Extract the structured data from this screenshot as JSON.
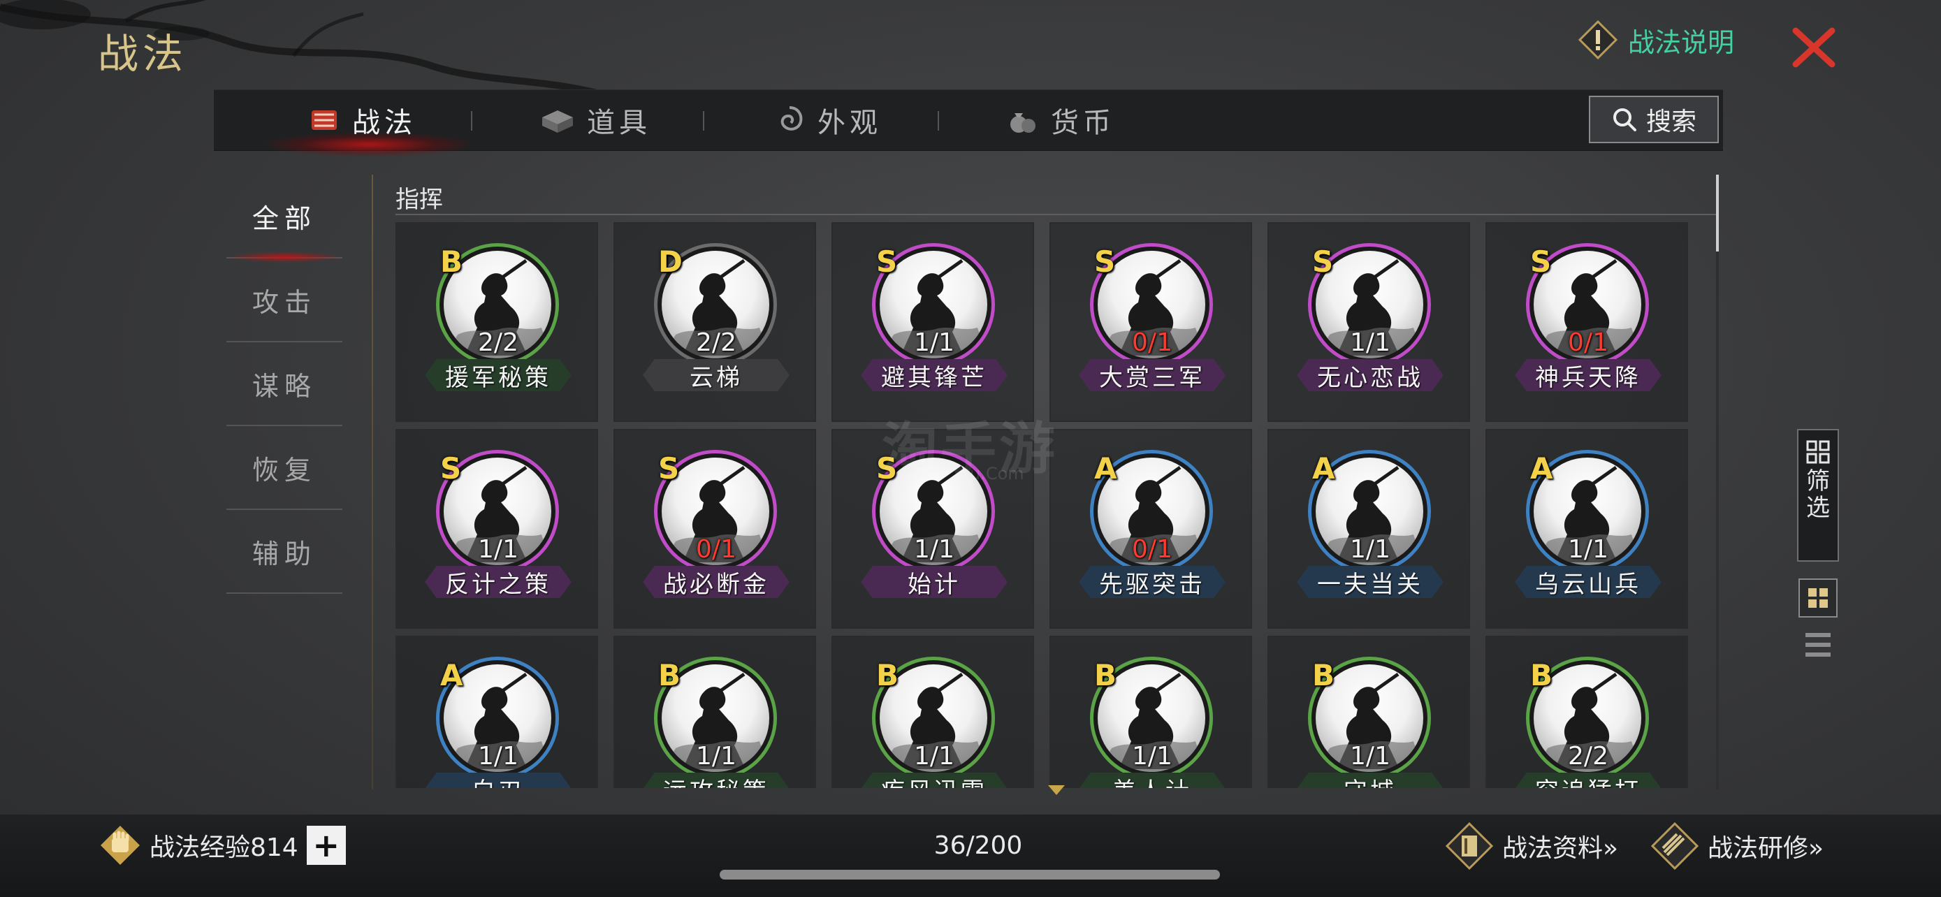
{
  "header": {
    "title": "战法",
    "help_label": "战法说明",
    "help_icon": "exclamation-diamond-icon",
    "close_icon": "close-x-icon"
  },
  "tabs": [
    {
      "label": "战法",
      "icon": "tactic-scroll-icon",
      "active": true
    },
    {
      "label": "道具",
      "icon": "item-box-icon",
      "active": false
    },
    {
      "label": "外观",
      "icon": "appearance-swirl-icon",
      "active": false
    },
    {
      "label": "货币",
      "icon": "currency-bag-icon",
      "active": false
    }
  ],
  "search": {
    "label": "搜索",
    "icon": "search-icon"
  },
  "sidebar": [
    {
      "label": "全部",
      "active": true
    },
    {
      "label": "攻击",
      "active": false
    },
    {
      "label": "谋略",
      "active": false
    },
    {
      "label": "恢复",
      "active": false
    },
    {
      "label": "辅助",
      "active": false
    }
  ],
  "section_label": "指挥",
  "grade_colors": {
    "S": "#c04cc8",
    "A": "#3f82c4",
    "B": "#5aa346",
    "D": "#6c6c6c"
  },
  "banner_colors": {
    "S": "#4a2a52",
    "A": "#25394e",
    "B": "#263d2a",
    "D": "#3d3d3f"
  },
  "cards": [
    {
      "name": "援军秘策",
      "grade": "B",
      "count": "2/2"
    },
    {
      "name": "云梯",
      "grade": "D",
      "count": "2/2"
    },
    {
      "name": "避其锋芒",
      "grade": "S",
      "count": "1/1"
    },
    {
      "name": "大赏三军",
      "grade": "S",
      "count": "0/1"
    },
    {
      "name": "无心恋战",
      "grade": "S",
      "count": "1/1"
    },
    {
      "name": "神兵天降",
      "grade": "S",
      "count": "0/1"
    },
    {
      "name": "反计之策",
      "grade": "S",
      "count": "1/1"
    },
    {
      "name": "战必断金",
      "grade": "S",
      "count": "0/1"
    },
    {
      "name": "始计",
      "grade": "S",
      "count": "1/1"
    },
    {
      "name": "先驱突击",
      "grade": "A",
      "count": "0/1"
    },
    {
      "name": "一夫当关",
      "grade": "A",
      "count": "1/1"
    },
    {
      "name": "乌云山兵",
      "grade": "A",
      "count": "1/1"
    },
    {
      "name": "白刃",
      "grade": "A",
      "count": "1/1"
    },
    {
      "name": "远攻秘策",
      "grade": "B",
      "count": "1/1"
    },
    {
      "name": "疾风迅雷",
      "grade": "B",
      "count": "1/1"
    },
    {
      "name": "美人计",
      "grade": "B",
      "count": "1/1"
    },
    {
      "name": "守城",
      "grade": "B",
      "count": "1/1"
    },
    {
      "name": "穷追猛打",
      "grade": "B",
      "count": "2/2"
    }
  ],
  "filter": {
    "label": "筛选",
    "icon": "filter-grid-icon"
  },
  "view_icons": {
    "grid": "grid-view-icon",
    "list": "list-view-icon"
  },
  "footer": {
    "exp_label": "战法经验814",
    "exp_icon": "fist-badge-icon",
    "plus_label": "+",
    "capacity": "36/200",
    "info_link": "战法资料»",
    "info_icon": "book-diamond-icon",
    "research_link": "战法研修»",
    "research_icon": "scroll-diamond-icon"
  },
  "watermark": {
    "main": "淘手游",
    "sub": "u.Com"
  }
}
